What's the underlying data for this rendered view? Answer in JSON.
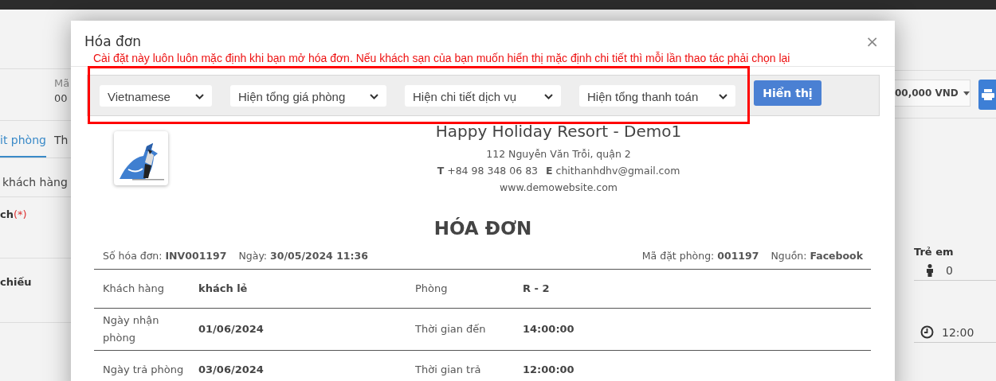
{
  "background": {
    "header_labels": [
      "Mã",
      "00"
    ],
    "tabs": [
      {
        "label": "it phòng",
        "selected": true
      },
      {
        "label": "Th",
        "selected": false
      }
    ],
    "section": "khách hàng",
    "field_labels": [
      {
        "label": "ch",
        "required_mark": "(*)"
      },
      {
        "label": "chiếu"
      }
    ],
    "total_dropdown": "00,000 VND",
    "children_label": "Trẻ em",
    "children_value": "0",
    "time_value": "12:00"
  },
  "modal": {
    "title": "Hóa đơn",
    "close": "×",
    "notice": "Cài đặt này luôn luôn mặc định khi bạn mở hóa đơn. Nếu khách sạn của bạn muốn hiển thị mặc định chi tiết thì mỗi lần thao tác phải chọn lại",
    "selects": [
      "Vietnamese",
      "Hiện tổng giá phòng",
      "Hiện chi tiết dịch vụ",
      "Hiện tổng thanh toán"
    ],
    "show_button": "Hiển thị"
  },
  "invoice": {
    "hotel_name": "Happy Holiday Resort - Demo1",
    "address": "112 Nguyễn Văn Trỗi, quận 2",
    "contacts": [
      "**T** +84 98 348 06 83",
      "**E** chithanhdhv@gmail.com"
    ],
    "website": "www.demowebsite.com",
    "title": "HÓA ĐƠN",
    "meta_left": [
      "Số hóa đơn: **INV001197**",
      "Ngày: **30/05/2024 11:36**"
    ],
    "meta_right": [
      "Mã đặt phòng: **001197**",
      "Nguồn: **Facebook**"
    ],
    "rows": [
      [
        {
          "label": "Khách hàng",
          "value": "khách lẻ"
        },
        {
          "label": "Phòng",
          "value": "R - 2"
        }
      ],
      [
        {
          "label": "Ngày nhận phòng",
          "value": "01/06/2024"
        },
        {
          "label": "Thời gian đến",
          "value": "14:00:00"
        }
      ],
      [
        {
          "label": "Ngày trả phòng",
          "value": "03/06/2024"
        },
        {
          "label": "Thời gian trả",
          "value": "12:00:00"
        }
      ]
    ]
  }
}
